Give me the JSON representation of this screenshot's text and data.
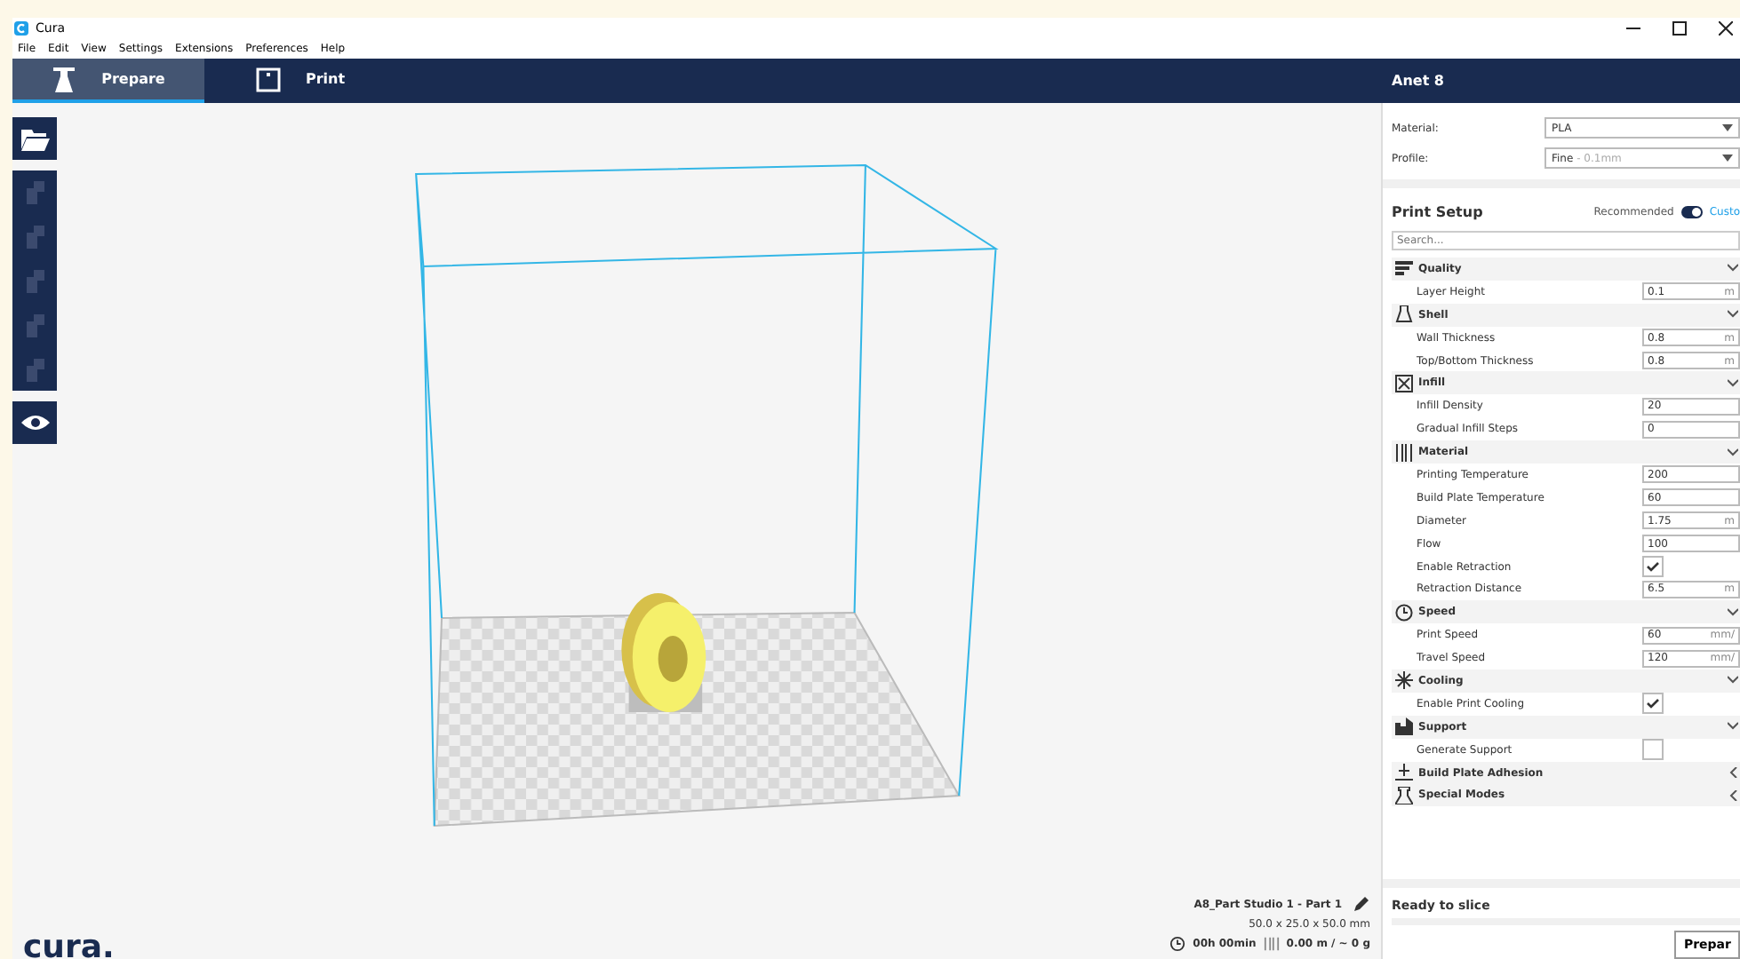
{
  "window": {
    "title": "Cura"
  },
  "menu": [
    "File",
    "Edit",
    "View",
    "Settings",
    "Extensions",
    "Preferences",
    "Help"
  ],
  "stages": [
    {
      "label": "Prepare",
      "kind": "prepare",
      "selected": true
    },
    {
      "label": "Print",
      "kind": "print",
      "selected": false
    }
  ],
  "printer": {
    "name": "Anet 8"
  },
  "material": {
    "label": "Material:",
    "value": "PLA"
  },
  "profile": {
    "label": "Profile:",
    "value": "Fine",
    "hint": "- 0.1mm"
  },
  "print_setup": {
    "title": "Print Setup",
    "recommended": "Recommended",
    "custom": "Custo",
    "custom_on": true,
    "search": {
      "placeholder": "Search..."
    }
  },
  "settings": [
    {
      "kind": "category",
      "label": "Quality",
      "expanded": true
    },
    {
      "kind": "field",
      "label": "Layer Height",
      "value": "0.1",
      "unit": "m"
    },
    {
      "kind": "category",
      "label": "Shell",
      "expanded": true
    },
    {
      "kind": "field",
      "label": "Wall Thickness",
      "value": "0.8",
      "unit": "m"
    },
    {
      "kind": "field",
      "label": "Top/Bottom Thickness",
      "value": "0.8",
      "unit": "m"
    },
    {
      "kind": "category",
      "label": "Infill",
      "expanded": true
    },
    {
      "kind": "field",
      "label": "Infill Density",
      "value": "20"
    },
    {
      "kind": "field",
      "label": "Gradual Infill Steps",
      "value": "0"
    },
    {
      "kind": "category",
      "label": "Material",
      "expanded": true
    },
    {
      "kind": "field",
      "label": "Printing Temperature",
      "value": "200"
    },
    {
      "kind": "field",
      "label": "Build Plate Temperature",
      "value": "60"
    },
    {
      "kind": "field",
      "label": "Diameter",
      "value": "1.75",
      "unit": "m"
    },
    {
      "kind": "field",
      "label": "Flow",
      "value": "100"
    },
    {
      "kind": "check",
      "label": "Enable Retraction",
      "checked": true
    },
    {
      "kind": "field",
      "label": "Retraction Distance",
      "value": "6.5",
      "unit": "m"
    },
    {
      "kind": "category",
      "label": "Speed",
      "expanded": true
    },
    {
      "kind": "field",
      "label": "Print Speed",
      "value": "60",
      "unit": "mm/"
    },
    {
      "kind": "field",
      "label": "Travel Speed",
      "value": "120",
      "unit": "mm/"
    },
    {
      "kind": "category",
      "label": "Cooling",
      "expanded": true
    },
    {
      "kind": "check",
      "label": "Enable Print Cooling",
      "checked": true
    },
    {
      "kind": "category",
      "label": "Support",
      "expanded": true
    },
    {
      "kind": "check",
      "label": "Generate Support",
      "checked": false
    },
    {
      "kind": "category",
      "label": "Build Plate Adhesion",
      "expanded": false
    },
    {
      "kind": "category",
      "label": "Special Modes",
      "expanded": false
    }
  ],
  "status": {
    "text": "Ready to slice",
    "level": 0,
    "button": "Prepar"
  },
  "job": {
    "name": "A8_Part Studio 1 - Part 1",
    "dimensions": "50.0 x 25.0 x 50.0 mm",
    "time": "00h 00min",
    "material": "0.00 m / ~ 0 g"
  },
  "logo": "cura."
}
